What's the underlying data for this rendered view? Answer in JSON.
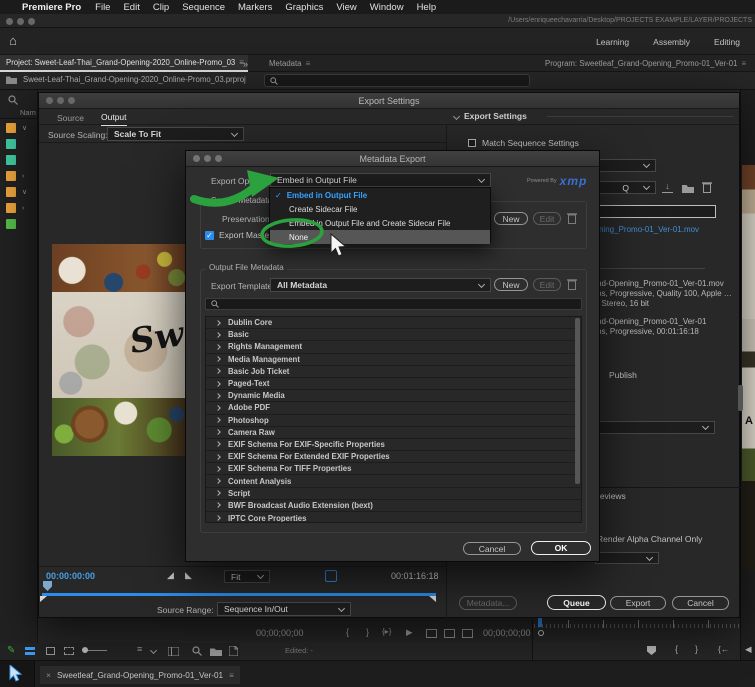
{
  "colors": {
    "accent_blue": "#2d8ceb",
    "link_blue": "#3f8fd6",
    "timecode_blue": "#46a0e8",
    "annotation_green": "#2ba23e",
    "xmp_blue": "#3b6fd4",
    "label_orange": "#e8a23a",
    "label_mint": "#3fc9a0",
    "label_green": "#53b848"
  },
  "menubar": {
    "apple_icon": "",
    "app_name": "Premiere Pro",
    "items": [
      "File",
      "Edit",
      "Clip",
      "Sequence",
      "Markers",
      "Graphics",
      "View",
      "Window",
      "Help"
    ]
  },
  "titlebar": {
    "path": "/Users/enriqueechavarria/Desktop/PROJECTS EXAMPLE/LAYER/PROJECTS"
  },
  "workspaces": {
    "items": [
      "Learning",
      "Assembly",
      "Editing"
    ]
  },
  "panels": {
    "project_tab": "Project: Sweet-Leaf-Thai_Grand-Opening-2020_Online-Promo_03",
    "overflow": "»",
    "menu_glyph": "≡",
    "metadata_tab": "Metadata",
    "program_tab": "Program: Sweetleaf_Grand-Opening_Promo-01_Ver-01",
    "project_file": "Sweet-Leaf-Thai_Grand-Opening-2020_Online-Promo_03.prproj",
    "name_column": "Nam",
    "bins": [
      {
        "color": "#e8a23a",
        "twirl": "∨"
      },
      {
        "color": "#3fc9a0",
        "twirl": ""
      },
      {
        "color": "#3fc9a0",
        "twirl": ""
      },
      {
        "color": "#e8a23a",
        "twirl": "›"
      },
      {
        "color": "#e8a23a",
        "twirl": "∨"
      },
      {
        "color": "#e8a23a",
        "twirl": "›"
      },
      {
        "color": "#53b848",
        "twirl": ""
      }
    ]
  },
  "export_window": {
    "title": "Export Settings",
    "tabs": [
      "Source",
      "Output"
    ],
    "source_scaling_label": "Source Scaling:",
    "source_scaling_value": "Scale To Fit",
    "preview_script": "Sw",
    "timecode": "00:00:00:00",
    "zoom_fit": "Fit",
    "duration": "00:01:16:18",
    "source_range_label": "Source Range:",
    "source_range_value": "Sequence In/Out",
    "settings_header": "Export Settings",
    "match_sequence": "Match Sequence Settings",
    "preset_tail": "Q",
    "output_link": "ning_Promo-01_Ver-01.mov",
    "summary_output": [
      "nd-Opening_Promo-01_Ver-01.mov",
      "ps, Progressive, Quality 100, Apple …",
      ", Stereo, 16 bit"
    ],
    "summary_source": [
      "nd-Opening_Promo-01_Ver-01",
      "ps, Progressive, 00:01:16:18"
    ],
    "publish": "Publish",
    "previews_tail": "reviews",
    "render_alpha": "Render Alpha Channel Only",
    "buttons": {
      "metadata": "Metadata...",
      "queue": "Queue",
      "export": "Export",
      "cancel": "Cancel"
    }
  },
  "metadata_dialog": {
    "title": "Metadata Export",
    "export_options_label": "Export Options:",
    "export_options_value": "Embed in Output File",
    "powered_by": "Powered By",
    "xmp": "xmp",
    "check": "✓",
    "menu": [
      "Embed in Output File",
      "Create Sidecar File",
      "Embed in Output File and Create Sidecar File",
      "None"
    ],
    "source_metadata": "Source Metadata",
    "preservation_rules": "Preservation Rules:",
    "export_master": "Export Master S",
    "new": "New",
    "edit": "Edit",
    "output_file_metadata": "Output File Metadata",
    "export_template_label": "Export Template:",
    "export_template_value": "All Metadata",
    "categories": [
      "Dublin Core",
      "Basic",
      "Rights Management",
      "Media Management",
      "Basic Job Ticket",
      "Paged-Text",
      "Dynamic Media",
      "Adobe PDF",
      "Photoshop",
      "Camera Raw",
      "EXIF Schema For EXIF-Specific Properties",
      "EXIF Schema For Extended EXIF Properties",
      "EXIF Schema For TIFF Properties",
      "Content Analysis",
      "Script",
      "BWF Broadcast Audio Extension (bext)",
      "IPTC Core Properties"
    ],
    "cancel": "Cancel",
    "ok": "OK"
  },
  "source_monitor": {
    "tc_left": "00;00;00;00",
    "tc_right": "00;00;00;00",
    "edited": "Edited: -"
  },
  "timeline": {
    "tab": "Sweetleaf_Grand-Opening_Promo-01_Ver-01",
    "close": "×"
  },
  "program_strip": {
    "letter": "A"
  }
}
